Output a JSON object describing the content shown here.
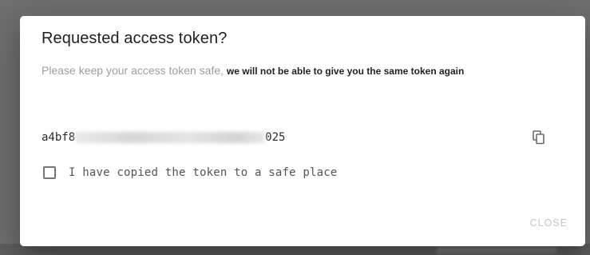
{
  "dialog": {
    "title": "Requested access token?",
    "description_light": "Please keep your access token safe,",
    "description_strong": "we will not be able to give you the same token again",
    "token_prefix": "a4bf8",
    "token_suffix": "025",
    "copy_icon": "copy-icon",
    "checkbox_label": "I have copied the token to a safe place",
    "checkbox_checked": false,
    "close_label": "CLOSE"
  },
  "colors": {
    "backdrop": "#6f6f6f",
    "dialog_bg": "#ffffff",
    "title": "#212121",
    "description": "#9e9e9e",
    "close_disabled": "#c6c6c6"
  }
}
